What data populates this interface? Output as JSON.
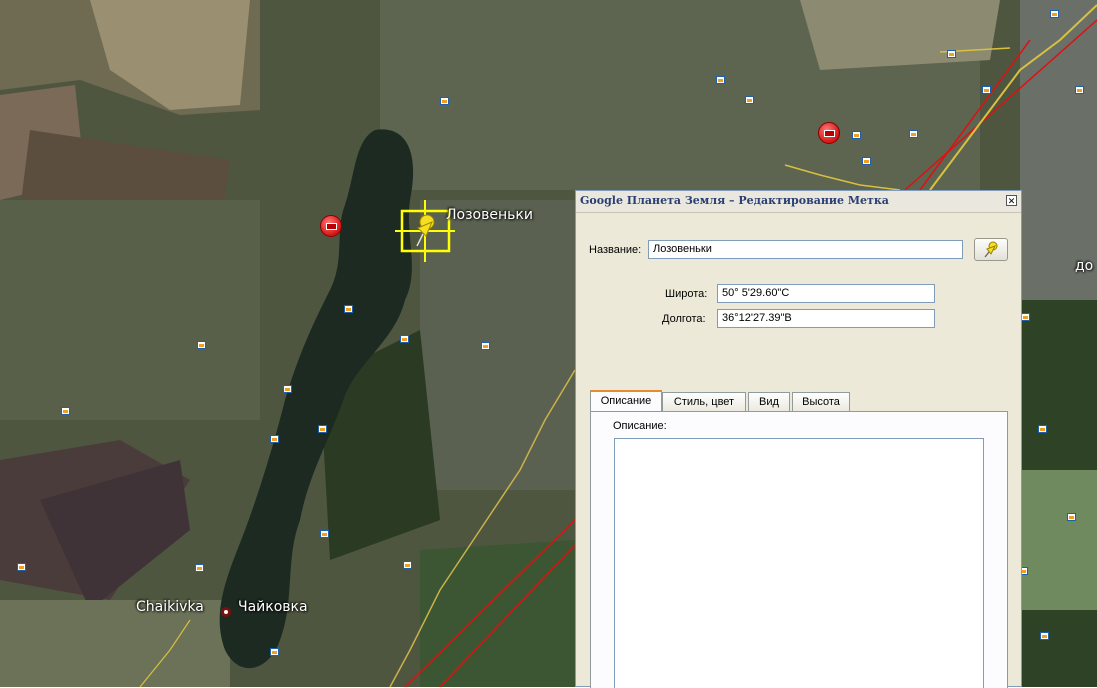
{
  "map": {
    "placemark_label": "Лозовеньки",
    "town_label_en": "Chaikivka",
    "town_label_ru": "Чайковка",
    "edge_label": "до"
  },
  "dialog": {
    "title": "Google Планета Земля – Редактирование Метка",
    "close_symbol": "✕",
    "name_label": "Название:",
    "name_value": "Лозовеньки",
    "lat_label": "Широта:",
    "lat_value": "50° 5'29.60\"С",
    "lon_label": "Долгота:",
    "lon_value": "36°12'27.39\"В",
    "tabs": [
      "Описание",
      "Стиль, цвет",
      "Вид",
      "Высота"
    ],
    "active_tab": "Описание",
    "description_label": "Описание:",
    "description_value": ""
  },
  "icons": {
    "pin_button_icon": "yellow-pushpin-icon",
    "placemark_icon": "yellow-pushpin-icon",
    "photo_icon": "photo-icon",
    "webcam_icon": "webcam-marker-icon"
  },
  "colors": {
    "dialog_bg": "#ece9d8",
    "title_color": "#2a3f73",
    "active_tab_accent": "#e68b2c",
    "placemark_highlight": "#ffff00",
    "road_red": "#e01010",
    "road_yellow": "#d8c040"
  }
}
